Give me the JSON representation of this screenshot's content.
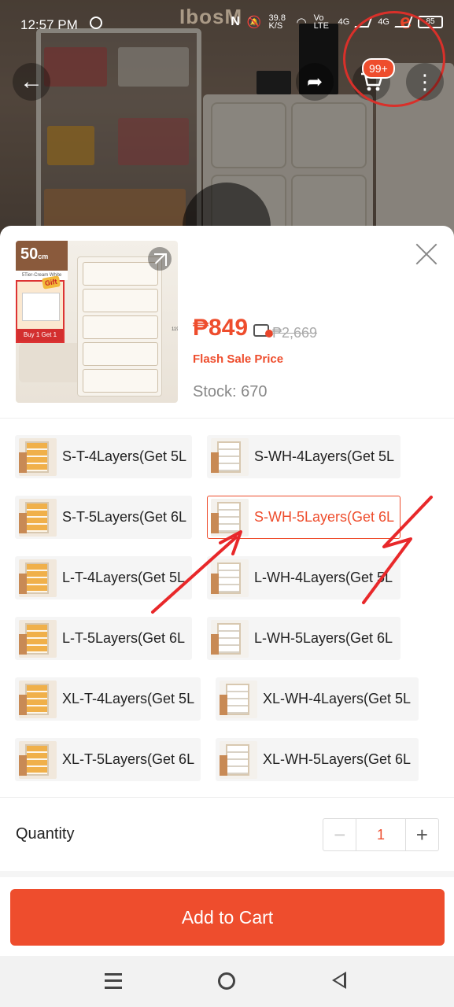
{
  "status_bar": {
    "time": "12:57 PM",
    "net_speed": "39.8 K/S",
    "network_1": "Vo LTE",
    "network_2": "4G",
    "network_3": "4G",
    "battery": "85"
  },
  "header": {
    "brand_watermark": "IbosM",
    "cart_badge": "99+"
  },
  "product": {
    "thumb_size_badge": "50",
    "thumb_size_unit": "cm",
    "thumb_subtitle": "5Tier-Cream White",
    "thumb_gift": "Gift",
    "thumb_buy": "Buy 1 Get 1",
    "thumb_height": "119cm",
    "price": "₱849",
    "old_price": "₱2,669",
    "price_type": "Flash Sale Price",
    "stock": "Stock: 670"
  },
  "variants": [
    {
      "label": "S-T-4Layers(Get 5L",
      "style": "t",
      "selected": false
    },
    {
      "label": "S-WH-4Layers(Get 5L",
      "style": "w",
      "selected": false
    },
    {
      "label": "S-T-5Layers(Get 6L",
      "style": "t",
      "selected": false
    },
    {
      "label": "S-WH-5Layers(Get 6L",
      "style": "w",
      "selected": true
    },
    {
      "label": "L-T-4Layers(Get 5L",
      "style": "t",
      "selected": false
    },
    {
      "label": "L-WH-4Layers(Get 5L",
      "style": "w",
      "selected": false
    },
    {
      "label": "L-T-5Layers(Get 6L",
      "style": "t",
      "selected": false
    },
    {
      "label": "L-WH-5Layers(Get 6L",
      "style": "w",
      "selected": false
    },
    {
      "label": "XL-T-4Layers(Get 5L",
      "style": "t",
      "selected": false
    },
    {
      "label": "XL-WH-4Layers(Get 5L",
      "style": "w",
      "selected": false
    },
    {
      "label": "XL-T-5Layers(Get 6L",
      "style": "t",
      "selected": false
    },
    {
      "label": "XL-WH-5Layers(Get 6L",
      "style": "w",
      "selected": false
    }
  ],
  "quantity": {
    "label": "Quantity",
    "minus": "−",
    "value": "1",
    "plus": "+"
  },
  "actions": {
    "add_to_cart": "Add to Cart"
  },
  "colors": {
    "accent": "#ee4d2d",
    "annotation": "#e8282a"
  },
  "icons": [
    "back-arrow-icon",
    "share-icon",
    "cart-icon",
    "more-icon",
    "play-icon",
    "expand-icon",
    "close-icon",
    "price-tag-icon",
    "menu-icon",
    "home-icon",
    "back-icon"
  ]
}
